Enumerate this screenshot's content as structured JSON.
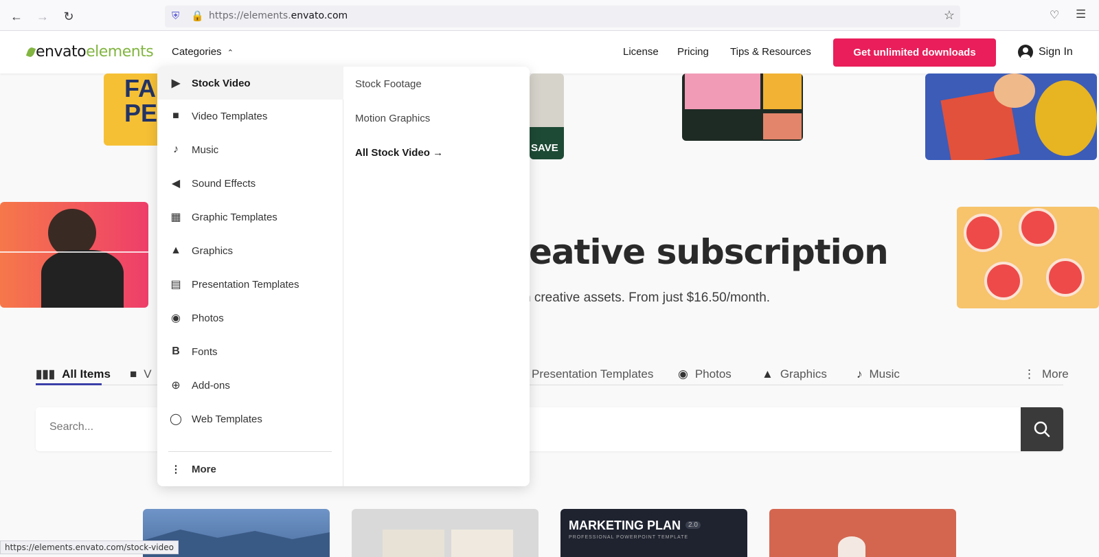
{
  "browser": {
    "url_prefix": "https://elements.",
    "url_domain": "envato.com",
    "status_url": "https://elements.envato.com/stock-video"
  },
  "header": {
    "logo_a": "envato",
    "logo_b": "elements",
    "categories_label": "Categories",
    "nav": [
      "License",
      "Pricing",
      "Tips & Resources"
    ],
    "cta_label": "Get unlimited downloads",
    "signin_label": "Sign In"
  },
  "hero": {
    "title_visible": "eative subscription",
    "subtitle_visible": "n creative assets. From just $16.50/month."
  },
  "tabs": [
    {
      "label": "All Items",
      "icon": "columns-icon"
    },
    {
      "label": "V",
      "icon": "video-camera-icon"
    },
    {
      "label": "Presentation Templates",
      "icon": "presentation-icon"
    },
    {
      "label": "Photos",
      "icon": "camera-icon"
    },
    {
      "label": "Graphics",
      "icon": "mountains-icon"
    },
    {
      "label": "Music",
      "icon": "music-note-icon"
    },
    {
      "label": "More",
      "icon": "vertical-dots-icon"
    }
  ],
  "search": {
    "placeholder": "Search..."
  },
  "dropdown": {
    "items": [
      {
        "label": "Stock Video",
        "icon": "play-icon"
      },
      {
        "label": "Video Templates",
        "icon": "video-camera-icon"
      },
      {
        "label": "Music",
        "icon": "music-note-icon"
      },
      {
        "label": "Sound Effects",
        "icon": "speaker-icon"
      },
      {
        "label": "Graphic Templates",
        "icon": "easel-image-icon"
      },
      {
        "label": "Graphics",
        "icon": "mountains-icon"
      },
      {
        "label": "Presentation Templates",
        "icon": "presentation-icon"
      },
      {
        "label": "Photos",
        "icon": "camera-icon"
      },
      {
        "label": "Fonts",
        "icon": "bold-b-icon"
      },
      {
        "label": "Add-ons",
        "icon": "plus-circle-icon"
      },
      {
        "label": "Web Templates",
        "icon": "globe-icon"
      }
    ],
    "more_label": "More",
    "sub": {
      "items": [
        "Stock Footage",
        "Motion Graphics"
      ],
      "all_label": "All Stock Video →"
    }
  },
  "cards": {
    "marketing_title": "MARKETING PLAN",
    "marketing_badge": "2.0",
    "marketing_sub": "PROFESSIONAL POWERPOINT TEMPLATE",
    "tile_save": "SAVE"
  },
  "colors": {
    "accent": "#e91e5a",
    "brand_green": "#82b541",
    "tab_underline": "#3b3fa8"
  }
}
